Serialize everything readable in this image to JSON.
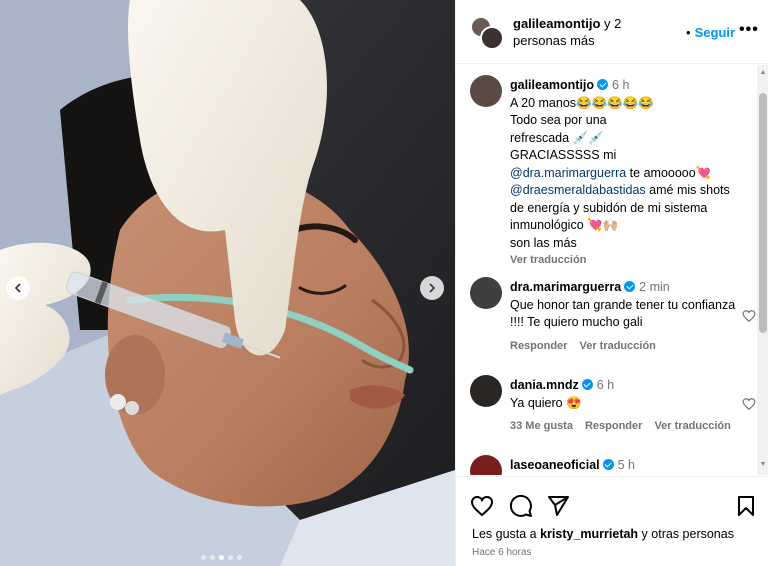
{
  "header": {
    "username": "galileamontijo",
    "others": "y 2 personas más",
    "separator": "•",
    "follow_label": "Seguir",
    "more_label": "•••"
  },
  "caption": {
    "username": "galileamontijo",
    "time": "6 h",
    "lines": [
      "A 20 manos😂😂😂😂😂",
      "Todo sea por una",
      "refrescada 💉💉",
      "GRACIASSSSS mi"
    ],
    "mention1": "@dra.marimarguerra",
    "after_mention1": " te amooooo💘",
    "mention2": "@draesmeraldabastidas",
    "after_mention2": " amé mis shots de energía y subidón de mi sistema inmunológico 💘🙌🏼",
    "last_line": "son las más",
    "translate_label": "Ver traducción"
  },
  "comments": [
    {
      "username": "dra.marimarguerra",
      "time": "2 min",
      "text": "Que honor tan grande tener tu confianza !!!! Te quiero mucho gali",
      "reply_label": "Responder",
      "translate_label": "Ver traducción"
    },
    {
      "username": "dania.mndz",
      "time": "6 h",
      "text": "Ya quiero 😍",
      "likes_label": "33 Me gusta",
      "reply_label": "Responder",
      "translate_label": "Ver traducción"
    },
    {
      "username": "laseoaneoficial",
      "time": "5 h"
    }
  ],
  "footer": {
    "likes_prefix": "Les gusta a ",
    "likes_user": "kristy_murrietah",
    "likes_suffix": " y otras personas",
    "time_ago": "Hace 6 horas"
  },
  "icons": {
    "like": "heart-icon",
    "comment": "comment-icon",
    "share": "share-icon",
    "save": "bookmark-icon",
    "verified": "verified-badge-icon",
    "nav_prev": "chevron-left-icon",
    "nav_next": "chevron-right-icon"
  },
  "colors": {
    "accent": "#0095f6",
    "mention": "#00376b",
    "muted": "#737373"
  },
  "carousel": {
    "slide_count": 5,
    "active_slide": 3
  }
}
